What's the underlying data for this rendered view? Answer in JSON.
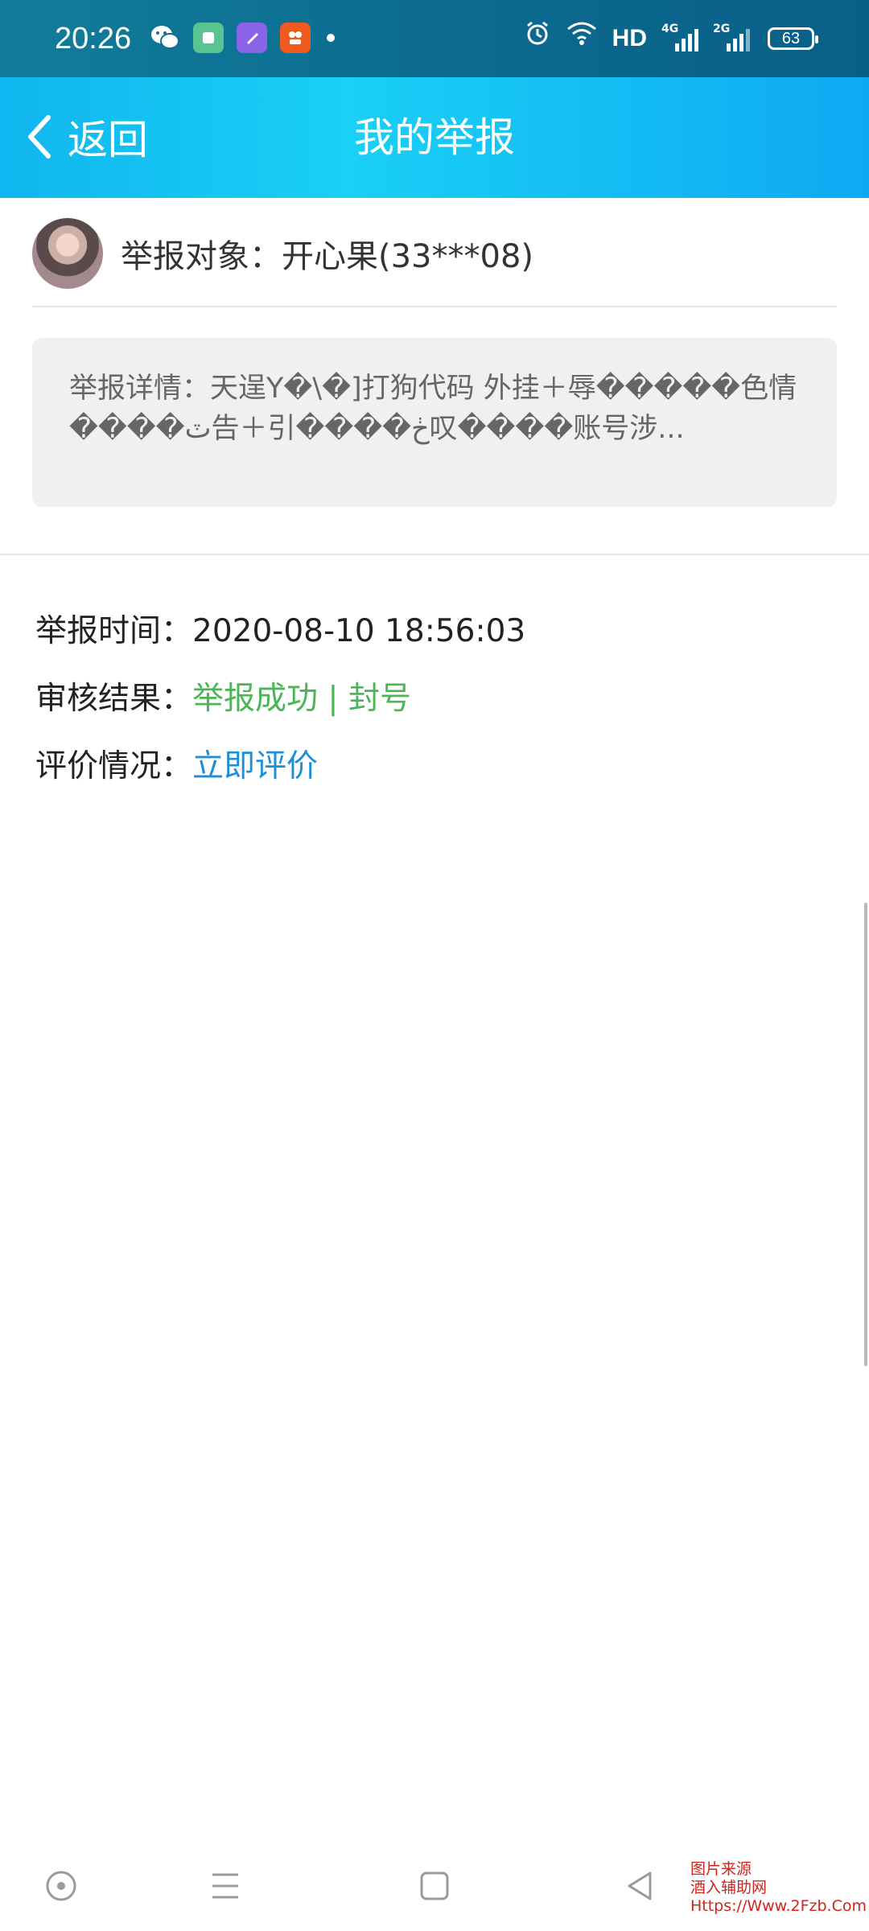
{
  "status_bar": {
    "time": "20:26",
    "app_icons": [
      {
        "name": "wechat-icon",
        "color": "#ffffff"
      },
      {
        "name": "app-green-icon",
        "color": "#59c48f"
      },
      {
        "name": "app-purple-icon",
        "color": "#8a63e6"
      },
      {
        "name": "app-orange-icon",
        "color": "#ef5a1f"
      }
    ],
    "hd_label": "HD",
    "network_1": "4G",
    "network_2": "2G",
    "battery": "63"
  },
  "header": {
    "back_label": "返回",
    "title": "我的举报",
    "gradient_colors": [
      "#10b6ef",
      "#19d0f5",
      "#0fa9f3"
    ]
  },
  "report": {
    "target_label": "举报对象：",
    "target_value": "开心果(33***08)",
    "detail_label": "举报详情：",
    "detail_value": "天逞Y�\\�]打狗代码 外挂＋辱�����色情����ٽ告＋引����ڂ叹����账号涉...",
    "time_label": "举报时间：",
    "time_value": "2020-08-10 18:56:03",
    "result_label": "审核结果：",
    "result_value": "举报成功 | 封号",
    "result_color": "#4bb557",
    "eval_label": "评价情况：",
    "eval_link": "立即评价",
    "eval_color": "#1d8fd8"
  },
  "watermark": {
    "line1": "图片来源",
    "line2": "酒入辅助网",
    "line3": "Https://Www.2Fzb.Com"
  }
}
